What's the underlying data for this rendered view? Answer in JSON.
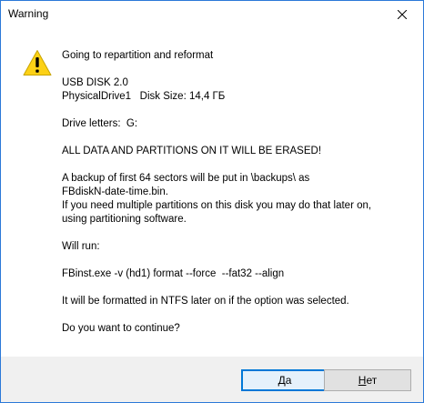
{
  "window": {
    "title": "Warning"
  },
  "icons": {
    "close": "close-icon",
    "warning": "warning-icon"
  },
  "colors": {
    "accent": "#0078d7",
    "window_border": "#2b79d8",
    "warning_yellow": "#fcd116",
    "footer_bg": "#f0f0f0"
  },
  "message": {
    "lines": [
      "Going to repartition and reformat",
      "",
      "USB DISK 2.0",
      "PhysicalDrive1   Disk Size: 14,4 ГБ",
      "",
      "Drive letters:  G:",
      "",
      "ALL DATA AND PARTITIONS ON IT WILL BE ERASED!",
      "",
      "A backup of first 64 sectors will be put in \\backups\\ as",
      "FBdiskN-date-time.bin.",
      "If you need multiple partitions on this disk you may do that later on,",
      "using partitioning software.",
      "",
      "Will run:",
      "",
      "FBinst.exe -v (hd1) format --force  --fat32 --align",
      "",
      "It will be formatted in NTFS later on if the option was selected.",
      "",
      "Do you want to continue?"
    ]
  },
  "buttons": {
    "yes": {
      "accel": "Д",
      "rest": "а"
    },
    "no": {
      "accel": "Н",
      "rest": "ет"
    }
  }
}
